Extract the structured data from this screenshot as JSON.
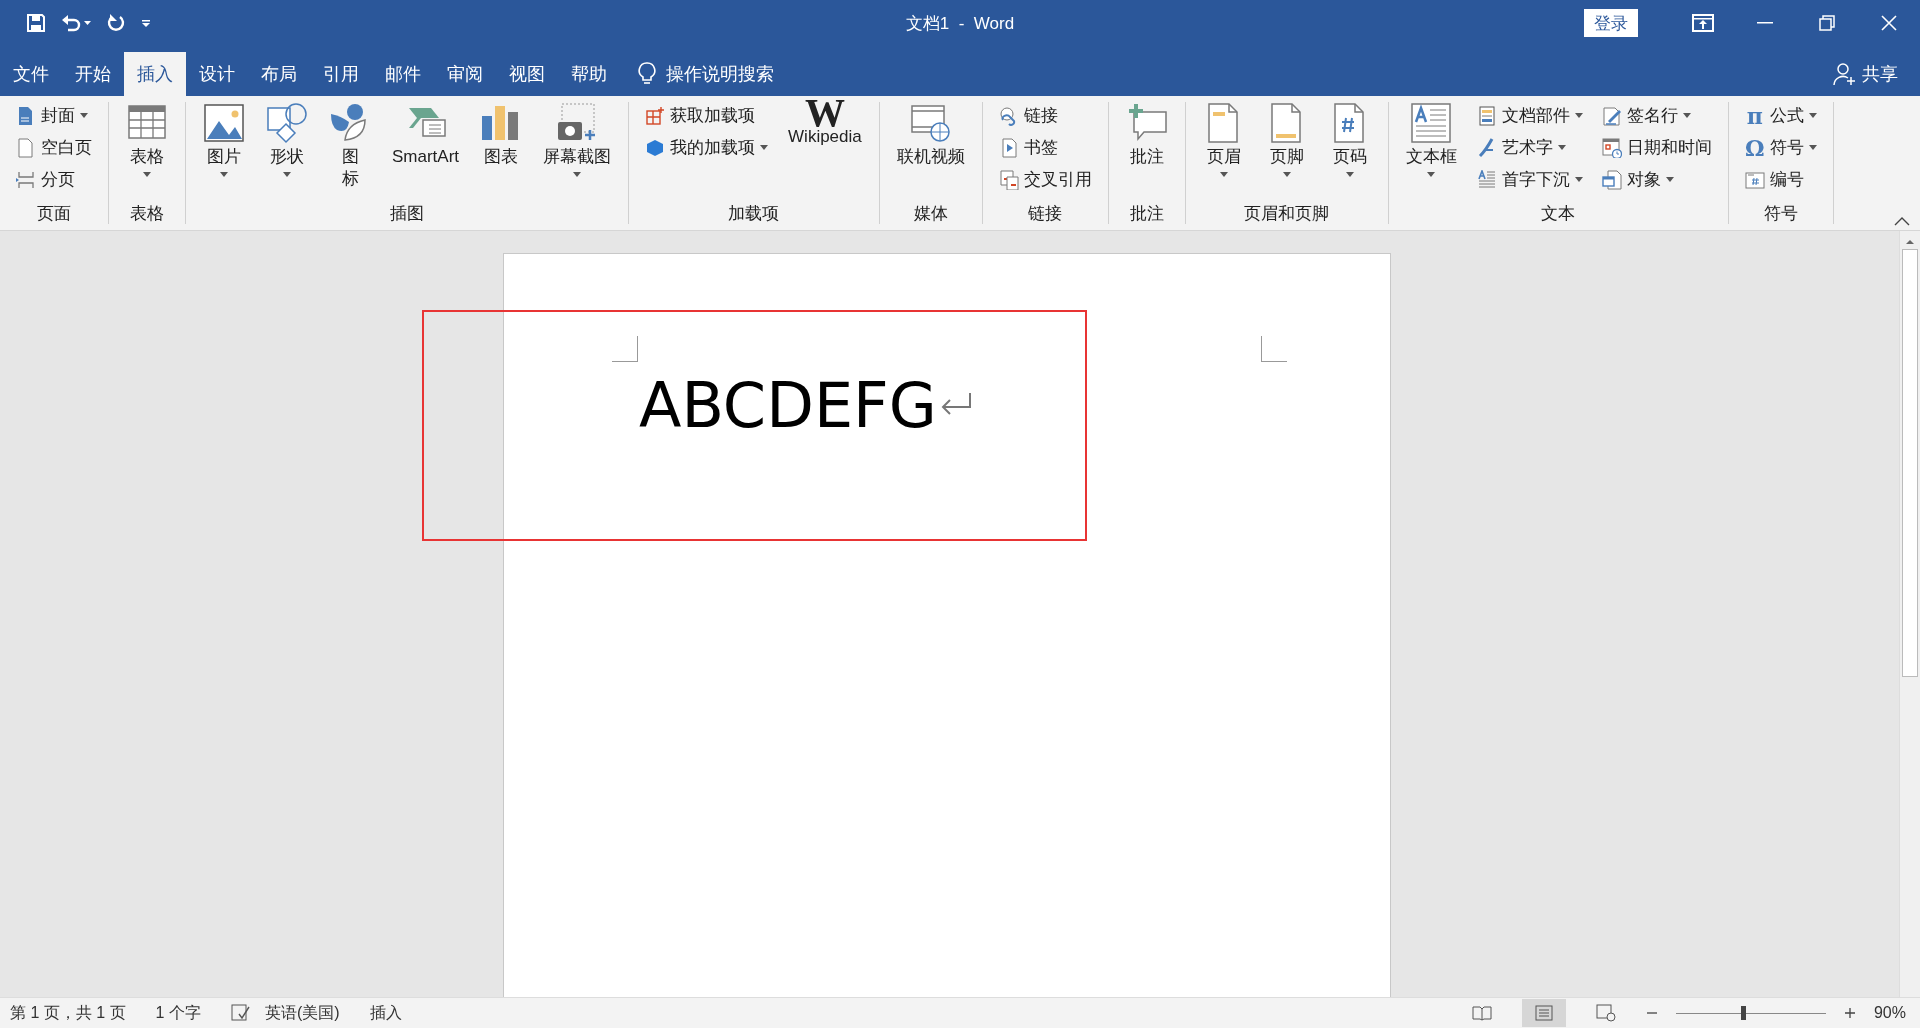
{
  "title_bar": {
    "title": "文档1  -  Word",
    "sign_in": "登录"
  },
  "tabs": [
    {
      "label": "文件",
      "selected": false
    },
    {
      "label": "开始",
      "selected": false
    },
    {
      "label": "插入",
      "selected": true
    },
    {
      "label": "设计",
      "selected": false
    },
    {
      "label": "布局",
      "selected": false
    },
    {
      "label": "引用",
      "selected": false
    },
    {
      "label": "邮件",
      "selected": false
    },
    {
      "label": "审阅",
      "selected": false
    },
    {
      "label": "视图",
      "selected": false
    },
    {
      "label": "帮助",
      "selected": false
    }
  ],
  "tell_me": "操作说明搜索",
  "share": "共享",
  "ribbon": [
    {
      "label": "页面",
      "items": [
        {
          "kind": "small",
          "label": "封面",
          "dropdown": true
        },
        {
          "kind": "small",
          "label": "空白页",
          "dropdown": false
        },
        {
          "kind": "small",
          "label": "分页",
          "dropdown": false
        }
      ]
    },
    {
      "label": "表格",
      "items": [
        {
          "kind": "large",
          "label": "表格",
          "dropdown": true
        }
      ]
    },
    {
      "label": "插图",
      "items": [
        {
          "kind": "large",
          "label": "图片",
          "dropdown": true
        },
        {
          "kind": "large",
          "label": "形状",
          "dropdown": true
        },
        {
          "kind": "large",
          "label": "图标",
          "dropdown": false,
          "narrow": true
        },
        {
          "kind": "large",
          "label": "SmartArt",
          "dropdown": false
        },
        {
          "kind": "large",
          "label": "图表",
          "dropdown": false
        },
        {
          "kind": "large",
          "label": "屏幕截图",
          "dropdown": true
        }
      ]
    },
    {
      "label": "加载项",
      "items": [
        {
          "kind": "small",
          "label": "获取加载项",
          "dropdown": false
        },
        {
          "kind": "small",
          "label": "我的加载项",
          "dropdown": true
        },
        {
          "kind": "large",
          "label": "Wikipedia",
          "dropdown": false,
          "glyph": "W"
        }
      ]
    },
    {
      "label": "媒体",
      "items": [
        {
          "kind": "large",
          "label": "联机视频",
          "dropdown": false
        }
      ]
    },
    {
      "label": "链接",
      "items": [
        {
          "kind": "small",
          "label": "链接",
          "dropdown": false
        },
        {
          "kind": "small",
          "label": "书签",
          "dropdown": false
        },
        {
          "kind": "small",
          "label": "交叉引用",
          "dropdown": false
        }
      ]
    },
    {
      "label": "批注",
      "items": [
        {
          "kind": "large",
          "label": "批注",
          "dropdown": false
        }
      ]
    },
    {
      "label": "页眉和页脚",
      "items": [
        {
          "kind": "large",
          "label": "页眉",
          "dropdown": true
        },
        {
          "kind": "large",
          "label": "页脚",
          "dropdown": true
        },
        {
          "kind": "large",
          "label": "页码",
          "dropdown": true
        }
      ]
    },
    {
      "label": "文本",
      "items": [
        {
          "kind": "large",
          "label": "文本框",
          "dropdown": true
        },
        {
          "kind": "small",
          "label": "文档部件",
          "dropdown": true
        },
        {
          "kind": "small",
          "label": "艺术字",
          "dropdown": true
        },
        {
          "kind": "small",
          "label": "首字下沉",
          "dropdown": true
        },
        {
          "kind": "small",
          "label": "签名行",
          "dropdown": true
        },
        {
          "kind": "small",
          "label": "日期和时间",
          "dropdown": false
        },
        {
          "kind": "small",
          "label": "对象",
          "dropdown": true
        }
      ]
    },
    {
      "label": "符号",
      "items": [
        {
          "kind": "small",
          "label": "公式",
          "dropdown": true,
          "glyph": "π"
        },
        {
          "kind": "small",
          "label": "符号",
          "dropdown": true,
          "glyph": "Ω"
        },
        {
          "kind": "small",
          "label": "编号",
          "dropdown": false
        }
      ]
    }
  ],
  "document": {
    "text": "ABCDEFG"
  },
  "status_bar": {
    "items": [
      "第 1 页，共 1 页",
      "1 个字",
      "英语(美国)",
      "插入"
    ],
    "zoom": "90%",
    "zoom_level": {
      "level": 0.45
    }
  }
}
